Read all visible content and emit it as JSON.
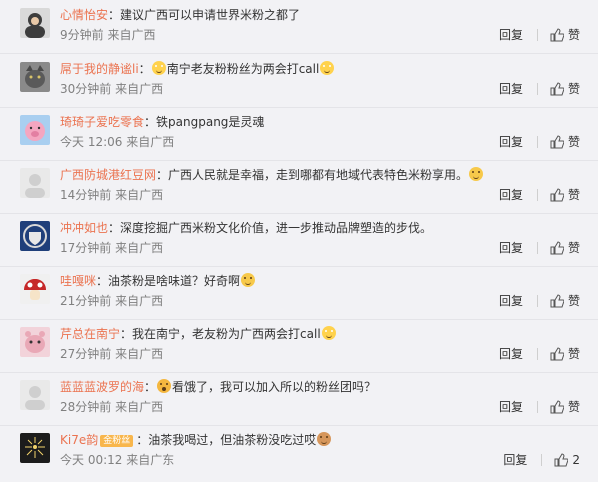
{
  "comments": [
    {
      "user": "心情怡安",
      "text": "建议广西可以申请世界米粉之都了",
      "emoji_after": "",
      "time": "9分钟前",
      "source": "来自广西",
      "reply": "回复",
      "like": "赞",
      "avatar_color": "#3d3d3d",
      "avatar_icon": "portrait"
    },
    {
      "user": "屌于我的静谧li",
      "text": "南宁老友粉粉丝为两会打call",
      "emoji_before": "cry",
      "emoji_after": "cry",
      "time": "30分钟前",
      "source": "来自广西",
      "reply": "回复",
      "like": "赞",
      "avatar_color": "#6b6b6b",
      "avatar_icon": "cat"
    },
    {
      "user": "琦琦子爱吃零食",
      "text": "铁pangpang是灵魂",
      "emoji_after": "",
      "time": "今天 12:06",
      "source": "来自广西",
      "reply": "回复",
      "like": "赞",
      "avatar_color": "#7fb3e3",
      "avatar_icon": "pig"
    },
    {
      "user": "广西防城港红豆网",
      "text": "广西人民就是幸福，走到哪都有地域代表特色米粉享用。",
      "emoji_after": "smile",
      "time": "14分钟前",
      "source": "来自广西",
      "reply": "回复",
      "like": "赞",
      "avatar_color": "#e8e8e8",
      "avatar_icon": "default"
    },
    {
      "user": "冲冲如也",
      "text": "深度挖掘广西米粉文化价值，进一步推动品牌塑造的步伐。",
      "emoji_after": "",
      "time": "17分钟前",
      "source": "来自广西",
      "reply": "回复",
      "like": "赞",
      "avatar_color": "#1f3f7a",
      "avatar_icon": "crest"
    },
    {
      "user": "哇嘎咪",
      "text": "油茶粉是啥味道？好奇啊",
      "emoji_after": "smile",
      "time": "21分钟前",
      "source": "来自广西",
      "reply": "回复",
      "like": "赞",
      "avatar_color": "#b32222",
      "avatar_icon": "mushroom"
    },
    {
      "user": "芹总在南宁",
      "text": "我在南宁，老友粉为广西两会打call",
      "emoji_after": "cry",
      "time": "27分钟前",
      "source": "来自广西",
      "reply": "回复",
      "like": "赞",
      "avatar_color": "#e8b3c0",
      "avatar_icon": "pet"
    },
    {
      "user": "蓝蓝蓝波罗的海",
      "text": "看饿了，我可以加入所以的粉丝团吗？",
      "emoji_before": "shock",
      "emoji_after": "",
      "time": "28分钟前",
      "source": "来自广西",
      "reply": "回复",
      "like": "赞",
      "avatar_color": "#e8e8e8",
      "avatar_icon": "default"
    },
    {
      "user": "Ki7e韵",
      "badge": "金粉丝",
      "text": "油茶我喝过，但油茶粉没吃过哎",
      "emoji_after": "monkey",
      "time": "今天 00:12",
      "source": "来自广东",
      "reply": "回复",
      "like": "2",
      "avatar_color": "#2a2a2a",
      "avatar_icon": "fireworks"
    }
  ],
  "colors": {
    "username": "#eb7350",
    "meta": "#808080",
    "text": "#333333",
    "background": "#f2f2f5"
  }
}
